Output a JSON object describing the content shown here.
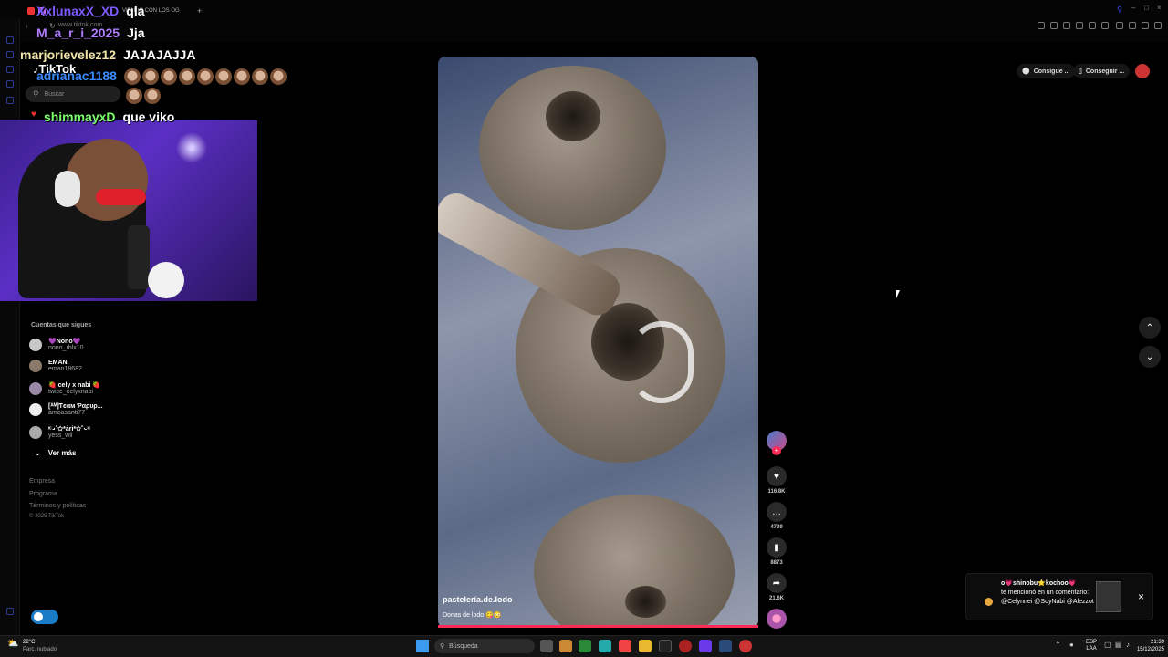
{
  "browser": {
    "tab_label": "VIENDO CON LOS OG",
    "url": "www.tiktok.com"
  },
  "chat": [
    {
      "user": "XxlunaxX_XD",
      "user_color": "#7c5cff",
      "message": "qla"
    },
    {
      "user": "M_a_r_i_2025",
      "user_color": "#b07cff",
      "message": "Jja"
    },
    {
      "user": "marjorievelez12",
      "user_color": "#f2e6a8",
      "message": "JAJAJAJJA"
    },
    {
      "user": "adrianac1188",
      "user_color": "#3a8cff",
      "message": ""
    },
    {
      "user": "shimmayxD",
      "user_color": "#7cff6a",
      "message": "que viko"
    }
  ],
  "sidebar": {
    "logo": "TikTok",
    "search_placeholder": "Buscar",
    "following_title": "Cuentas que sigues",
    "accounts": [
      {
        "name": "💜Nono💜",
        "handle": "nono_rblx10"
      },
      {
        "name": "EMAN",
        "handle": "eman18682"
      },
      {
        "name": "🍓 cely x nabi 🍓",
        "handle": "twice_celyxnabi"
      },
      {
        "name": "[ᴬᴹ]Ƭєαм Ƥαρυρ...",
        "handle": "amoasanti77"
      },
      {
        "name": "ᶦᶜ ̵̵·˚✩*ȧri*✩˚·̵̵ ᶦᶜ",
        "handle": "yess_wii"
      }
    ],
    "see_more": "Ver más",
    "footer": [
      "Empresa",
      "Programa",
      "Términos y políticas",
      "© 2025 TikTok"
    ]
  },
  "video": {
    "author": "pastelería.de.lodo",
    "caption": "Donas de lodo 😋😳",
    "progress": 1.0
  },
  "actions": {
    "likes": "116.8K",
    "comments": "4739",
    "saves": "8873",
    "shares": "21.6K"
  },
  "top_pills": [
    "Consigue ...",
    "Conseguir ..."
  ],
  "notification": {
    "user": "o💗shinobu⭐kochoo💗",
    "text": "te mencionó en un comentario: @Celynnei @SoyNabi @Alezzot"
  },
  "taskbar": {
    "weather_temp": "22°C",
    "weather_desc": "Parc. nublado",
    "search": "Búsqueda",
    "lang": "ESP",
    "lang_sub": "LAA",
    "time": "21:39",
    "date": "15/12/2025"
  }
}
